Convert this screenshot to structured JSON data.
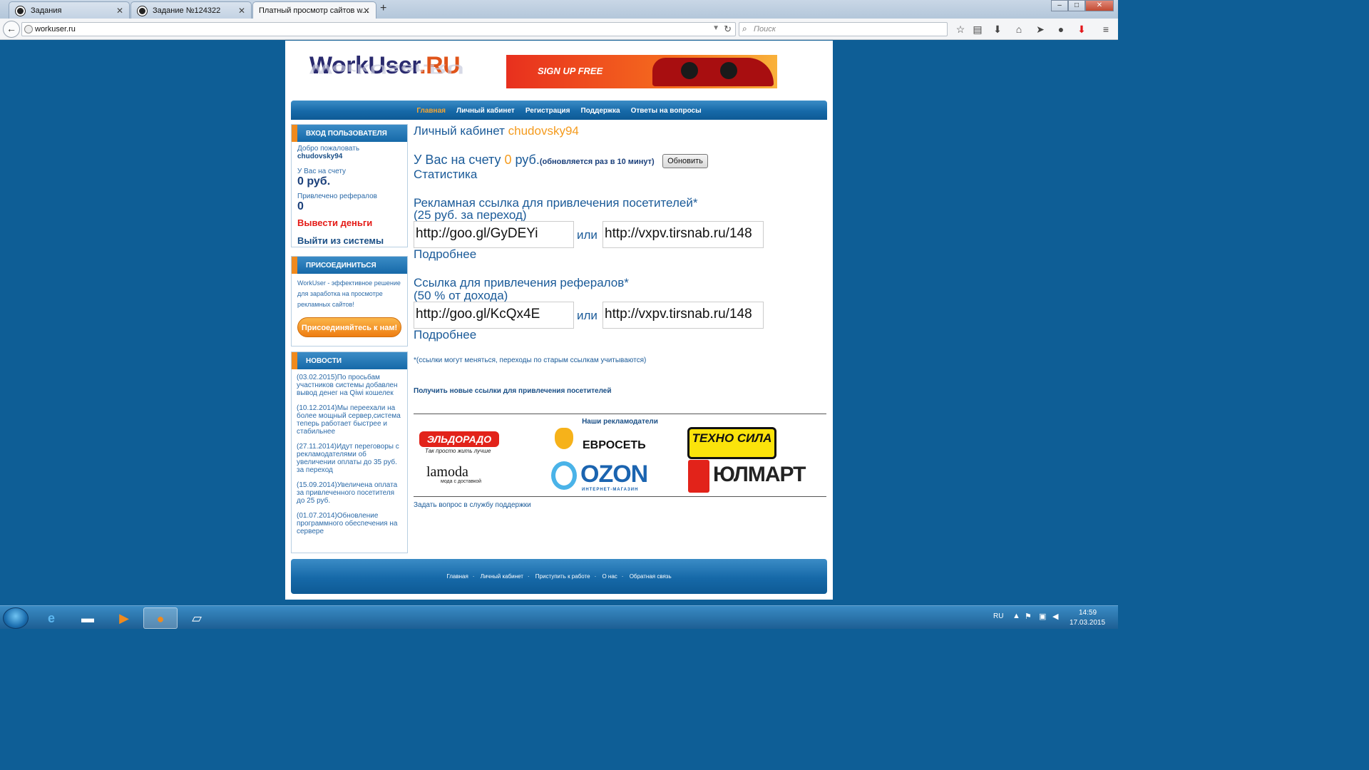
{
  "browser": {
    "tabs": [
      {
        "title": "Задания"
      },
      {
        "title": "Задание №124322"
      },
      {
        "title": "Платный просмотр сайтов w..."
      }
    ],
    "new_tab": "+",
    "window_buttons": {
      "min": "–",
      "max": "□",
      "close": "✕"
    },
    "url": "workuser.ru",
    "search_placeholder": "Поиск"
  },
  "site": {
    "logo_main": "WorkUser",
    "logo_ru": ".RU",
    "banner_text": "SIGN UP FREE",
    "nav": [
      "Главная",
      "Личный кабинет",
      "Регистрация",
      "Поддержка",
      "Ответы на вопросы"
    ],
    "login_box": {
      "title": "ВХОД ПОЛЬЗОВАТЕЛЯ",
      "welcome": "Добро пожаловать",
      "username": "chudovsky94",
      "balance_label": "У Вас на счету",
      "balance_value": "0 руб.",
      "referrals_label": "Привлечено рефералов",
      "referrals_value": "0",
      "withdraw": "Вывести деньги",
      "logout": "Выйти из системы"
    },
    "join_box": {
      "title": "ПРИСОЕДИНИТЬСЯ",
      "text": "WorkUser - эффективное решение для заработка на просмотре рекламных сайтов!",
      "button": "Присоединяйтесь к нам!"
    },
    "news_box": {
      "title": "НОВОСТИ",
      "items": [
        "(03.02.2015)По просьбам участников системы добавлен вывод денег на Qiwi кошелек",
        "(10.12.2014)Мы переехали на более мощный сервер,система теперь работает быстрее и стабильнее",
        "(27.11.2014)Идут переговоры с рекламодателями об увеличении оплаты до 35 руб. за переход",
        "(15.09.2014)Увеличена оплата за привлеченного посетителя до 25 руб.",
        "(01.07.2014)Обновление программного обеспечения на сервере"
      ]
    },
    "main": {
      "title_prefix": "Личный кабинет",
      "title_user": "chudovsky94",
      "account_prefix": "У Вас на счету",
      "account_value": "0",
      "account_suffix": "руб.",
      "account_note": "(обновляется раз в 10 минут)",
      "refresh_button": "Обновить",
      "stats_link": "Статистика",
      "ad_link_title": "Рекламная ссылка для привлечения посетителей*",
      "ad_link_sub": "(25 руб. за переход)",
      "ad_link_short": "http://goo.gl/GyDEYi",
      "or": "или",
      "ad_link_long": "http://vxpv.tirsnab.ru/148",
      "more": "Подробнее",
      "ref_link_title": "Ссылка для привлечения рефералов*",
      "ref_link_sub": "(50 % от дохода)",
      "ref_link_short": "http://goo.gl/KcQx4E",
      "ref_link_long": "http://vxpv.tirsnab.ru/148",
      "note": "*(ссылки могут меняться, переходы по старым ссылкам учитываются)",
      "get_new": "Получить новые ссылки для привлечения посетителей",
      "advertisers_title": "Наши рекламодатели",
      "brands": {
        "eldorado": "ЭЛЬДОРАДО",
        "eldorado_tag": "Так просто жить лучше",
        "euroset": "ЕВРОСЕТЬ",
        "tehnosila": "ТЕХНО СИЛА",
        "lamoda": "lamoda",
        "lamoda_tag": "мода с доставкой",
        "ozon": "OZON",
        "ozon_tag": "ИНТЕРНЕТ-МАГАЗИН",
        "ulmart": "ЮЛМАРТ"
      },
      "support_link": "Задать вопрос в службу поддержки"
    },
    "footer": [
      "Главная",
      "Личный кабинет",
      "Приступить к работе",
      "О нас",
      "Обратная связь"
    ],
    "footer_sep": "·"
  },
  "taskbar": {
    "lang": "RU",
    "time": "14:59",
    "date": "17.03.2015"
  }
}
